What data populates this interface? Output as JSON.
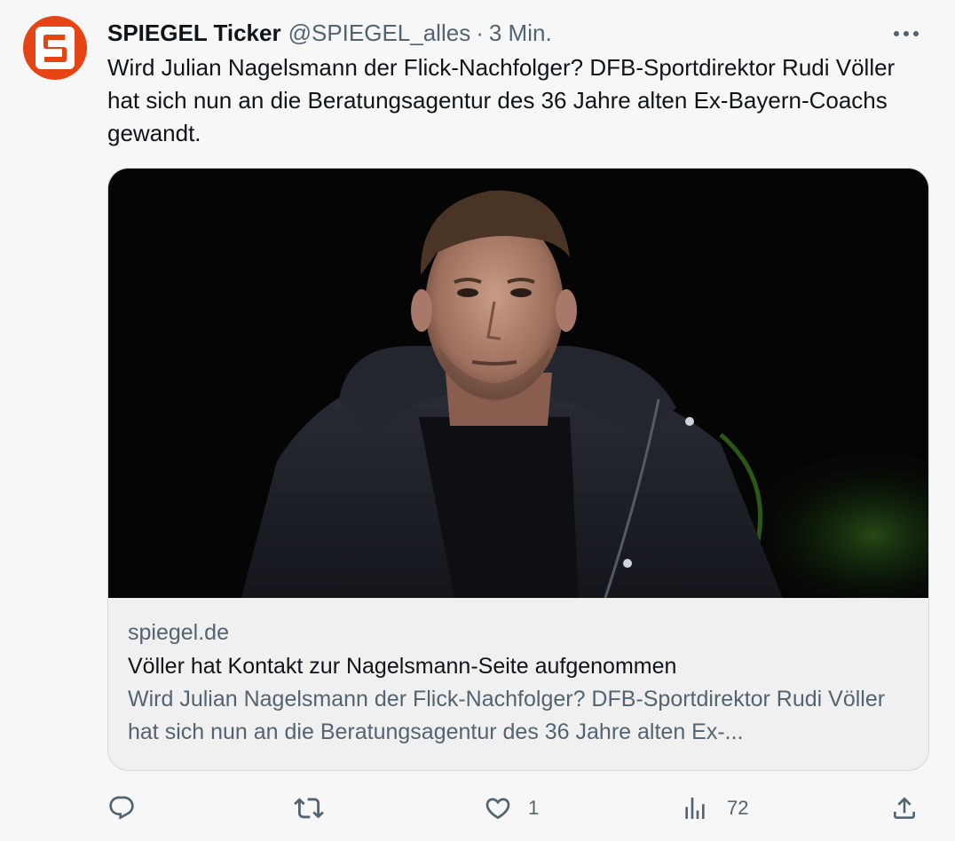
{
  "account": {
    "display_name": "SPIEGEL Ticker",
    "handle": "@SPIEGEL_alles",
    "separator": "·",
    "timestamp": "3 Min.",
    "avatar_letter": "S",
    "avatar_color": "#e64415"
  },
  "tweet": {
    "text": "Wird Julian Nagelsmann der Flick-Nachfolger? DFB-Sportdirektor Rudi Völler hat sich nun an die Beratungsagentur des 36 Jahre alten Ex-Bayern-Coachs gewandt."
  },
  "card": {
    "domain": "spiegel.de",
    "title": "Völler hat Kontakt zur Nagelsmann-Seite aufgenommen",
    "description": "Wird Julian Nagelsmann der Flick-Nachfolger? DFB-Sportdirektor Rudi Völler hat sich nun an die Beratungsagentur des 36 Jahre alten Ex-..."
  },
  "actions": {
    "reply": {
      "icon": "reply-icon",
      "count": ""
    },
    "retweet": {
      "icon": "retweet-icon",
      "count": ""
    },
    "like": {
      "icon": "heart-icon",
      "count": "1"
    },
    "views": {
      "icon": "views-icon",
      "count": "72"
    },
    "share": {
      "icon": "share-icon",
      "count": ""
    }
  },
  "colors": {
    "text_primary": "#0f1419",
    "text_secondary": "#536471",
    "border": "#cfd9de",
    "background": "#f7f7f7"
  }
}
